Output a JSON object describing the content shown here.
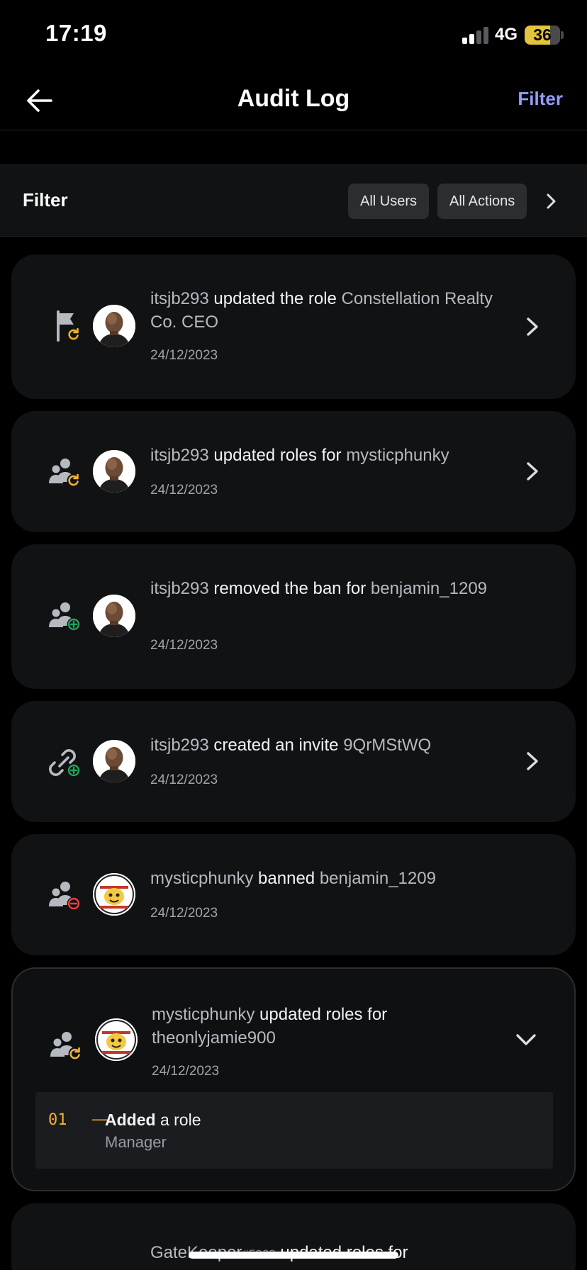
{
  "status": {
    "time": "17:19",
    "network": "4G",
    "battery": "36"
  },
  "nav": {
    "title": "Audit Log",
    "filter_label": "Filter"
  },
  "filter_bar": {
    "label": "Filter",
    "users_chip": "All Users",
    "actions_chip": "All Actions"
  },
  "entries": [
    {
      "icon": "role-update-icon",
      "actor": "itsjb293",
      "action": " updated the role ",
      "target": "Constellation Realty Co. CEO",
      "date": "24/12/2023",
      "expandable": true
    },
    {
      "icon": "member-role-update-icon",
      "actor": "itsjb293",
      "action": " updated roles for ",
      "target": "mysticphunky",
      "date": "24/12/2023",
      "expandable": true
    },
    {
      "icon": "member-unban-icon",
      "actor": "itsjb293",
      "action": " removed the ban for ",
      "target": "benjamin_1209",
      "date": "24/12/2023",
      "expandable": false
    },
    {
      "icon": "invite-create-icon",
      "actor": "itsjb293",
      "action": " created an invite ",
      "target": "9QrMStWQ",
      "date": "24/12/2023",
      "expandable": true
    },
    {
      "icon": "member-ban-icon",
      "actor": "mysticphunky",
      "action": " banned ",
      "target": "benjamin_1209",
      "date": "24/12/2023",
      "expandable": false
    },
    {
      "icon": "member-role-update-icon",
      "actor": "mysticphunky",
      "action": " updated roles for ",
      "target": "theonlyjamie900",
      "date": "24/12/2023",
      "expandable": true,
      "changes": [
        {
          "number": "01",
          "dash": "—",
          "verb": "Added",
          "rest": " a role",
          "value": "Manager"
        }
      ]
    }
  ],
  "peek_entry": {
    "actor": "GateKeeper",
    "discriminator": "#5963",
    "action": " updated roles for"
  },
  "colors": {
    "accent": "#949cf7",
    "warning": "#f0b232",
    "success": "#23a55a",
    "danger": "#f23f43"
  }
}
